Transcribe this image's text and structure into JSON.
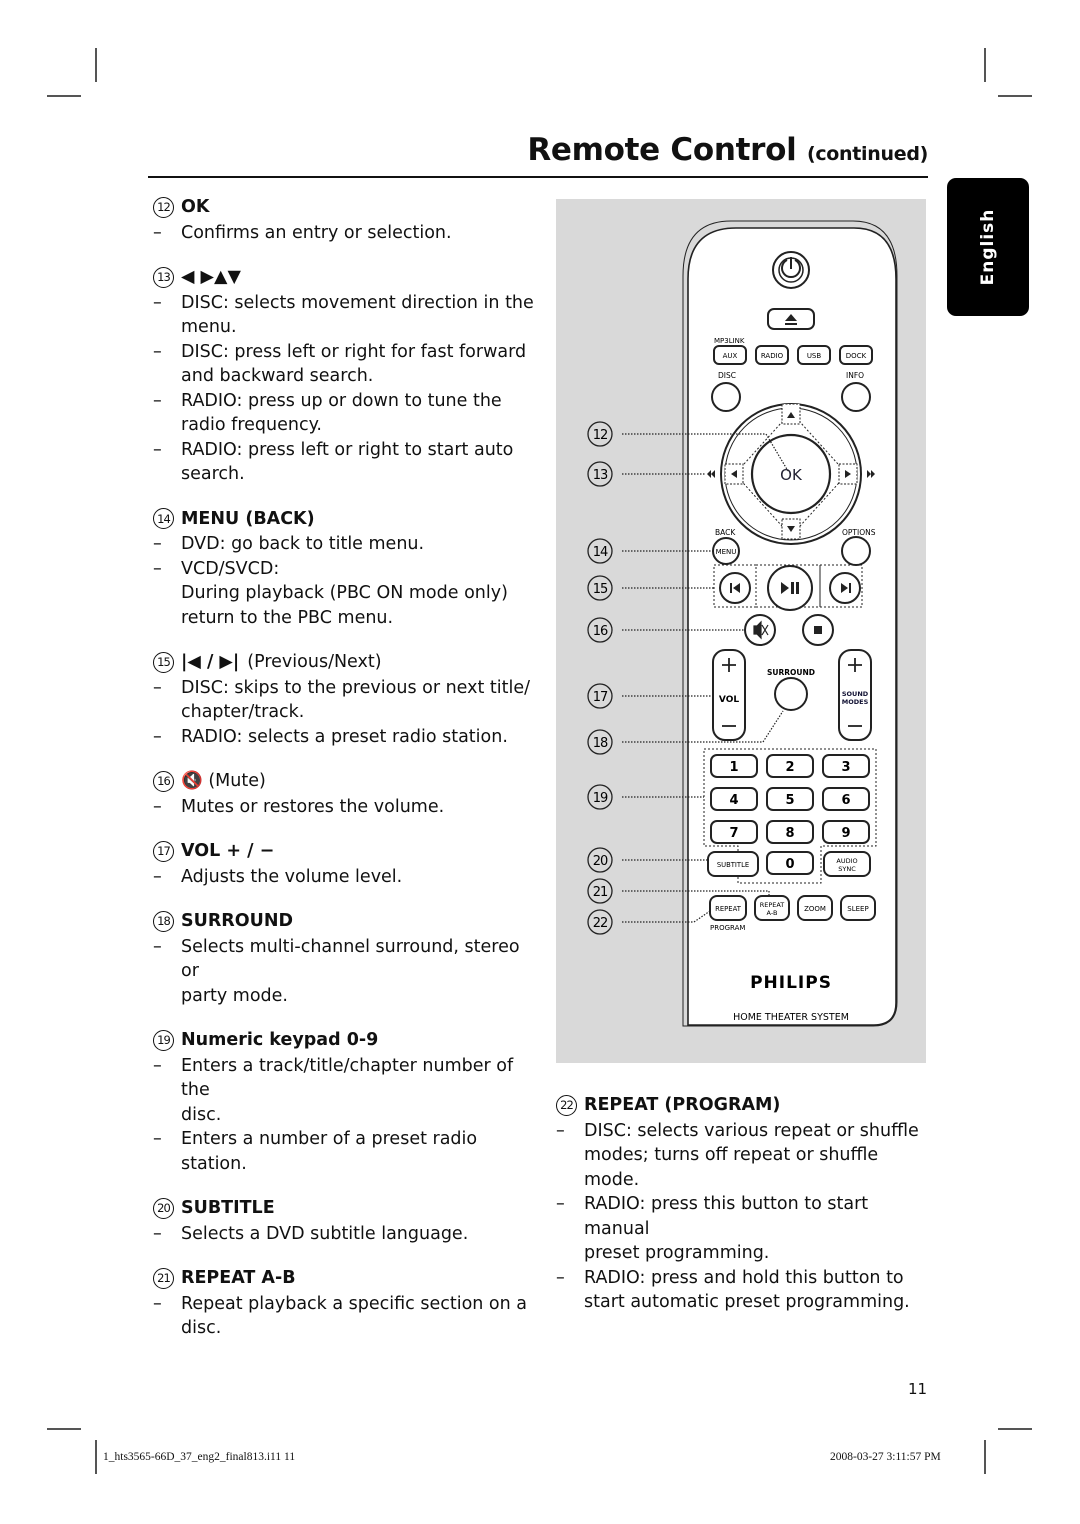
{
  "header": {
    "title": "Remote Control",
    "title_suffix": "(continued)",
    "language_tab": "English"
  },
  "items_left": [
    {
      "num": "12",
      "title": "OK",
      "extra": "",
      "lines": [
        [
          "Confirms an entry or selection."
        ]
      ]
    },
    {
      "num": "13",
      "title": "◀ ▶▲▼",
      "extra": "",
      "lines": [
        [
          "DISC: selects movement direction in the",
          "menu."
        ],
        [
          "DISC: press left or right for fast forward",
          "and backward search."
        ],
        [
          "RADIO: press up or down to tune the",
          "radio frequency."
        ],
        [
          "RADIO: press left or right to start auto",
          "search."
        ]
      ]
    },
    {
      "num": "14",
      "title": "MENU (BACK)",
      "extra": "",
      "lines": [
        [
          "DVD: go back to title menu."
        ],
        [
          "VCD/SVCD:",
          "During playback (PBC ON mode only)",
          "return to the PBC menu."
        ]
      ]
    },
    {
      "num": "15",
      "title": "|◀ / ▶|",
      "extra": "(Previous/Next)",
      "lines": [
        [
          "DISC: skips to the previous or next title/",
          "chapter/track."
        ],
        [
          "RADIO: selects a preset radio station."
        ]
      ]
    },
    {
      "num": "16",
      "title": "",
      "extra": "🔇 (Mute)",
      "lines": [
        [
          "Mutes or restores the volume."
        ]
      ]
    },
    {
      "num": "17",
      "title": "VOL  + / −",
      "extra": "",
      "lines": [
        [
          "Adjusts the volume level."
        ]
      ]
    },
    {
      "num": "18",
      "title": "SURROUND",
      "extra": "",
      "lines": [
        [
          "Selects multi-channel surround, stereo or",
          "party mode."
        ]
      ]
    },
    {
      "num": "19",
      "title": "Numeric keypad 0-9",
      "extra": "",
      "lines": [
        [
          "Enters a track/title/chapter number of the",
          "disc."
        ],
        [
          "Enters a number of a preset radio station."
        ]
      ]
    },
    {
      "num": "20",
      "title": "SUBTITLE",
      "extra": "",
      "lines": [
        [
          "Selects a DVD subtitle language."
        ]
      ]
    },
    {
      "num": "21",
      "title": "REPEAT A-B",
      "extra": "",
      "lines": [
        [
          "Repeat playback a specific section on a",
          "disc."
        ]
      ]
    }
  ],
  "items_right": [
    {
      "num": "22",
      "title": "REPEAT (PROGRAM)",
      "extra": "",
      "lines": [
        [
          "DISC: selects various repeat or shuffle",
          "modes; turns off repeat or shuffle mode."
        ],
        [
          "RADIO: press this button to start manual",
          "preset programming."
        ],
        [
          "RADIO: press and hold this button to",
          "start automatic preset programming."
        ]
      ]
    }
  ],
  "bullet_dash": "–",
  "remote": {
    "callouts": [
      "12",
      "13",
      "14",
      "15",
      "16",
      "17",
      "18",
      "19",
      "20",
      "21",
      "22"
    ],
    "labels": {
      "mp3link": "MP3LINK",
      "aux": "AUX",
      "radio": "RADIO",
      "usb": "USB",
      "dock": "DOCK",
      "disc": "DISC",
      "info": "INFO",
      "ok": "OK",
      "back": "BACK",
      "menu": "MENU",
      "options": "OPTIONS",
      "surround": "SURROUND",
      "vol": "VOL",
      "sound_modes_1": "SOUND",
      "sound_modes_2": "MODES",
      "subtitle": "SUBTITLE",
      "audio_sync_1": "AUDIO",
      "audio_sync_2": "SYNC",
      "repeat": "REPEAT",
      "repeat_ab_1": "REPEAT",
      "repeat_ab_2": "A-B",
      "zoom": "ZOOM",
      "sleep": "SLEEP",
      "program": "PROGRAM",
      "brand": "PHILIPS",
      "product": "HOME THEATER SYSTEM"
    },
    "keypad": [
      "1",
      "2",
      "3",
      "4",
      "5",
      "6",
      "7",
      "8",
      "9",
      "0"
    ],
    "panel_color": "#d9d9d9"
  },
  "footer": {
    "page_number": "11",
    "file_info": "1_hts3565-66D_37_eng2_final813.i11   11",
    "timestamp": "2008-03-27   3:11:57 PM"
  }
}
